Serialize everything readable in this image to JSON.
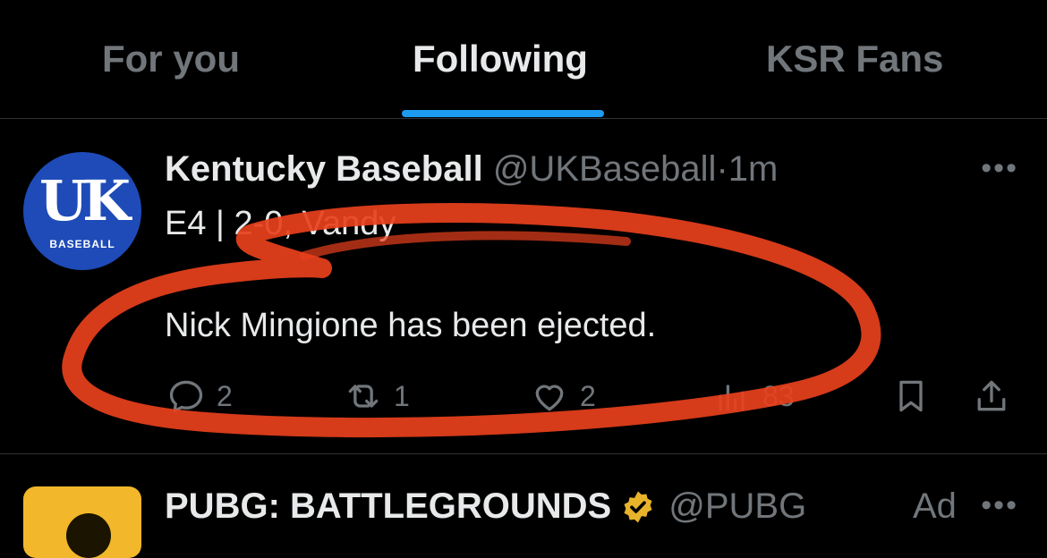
{
  "tabs": [
    "For you",
    "Following",
    "KSR Fans"
  ],
  "post": {
    "author_name": "Kentucky Baseball",
    "author_handle": "@UKBaseball",
    "separator": "·",
    "time": "1m",
    "subline": "E4 | 2-0, Vandy",
    "text": "Nick Mingione has been ejected.",
    "avatar_text": "UK",
    "avatar_subtext": "BASEBALL",
    "replies": "2",
    "reposts": "1",
    "likes": "2",
    "views": "83"
  },
  "post2": {
    "author_name": "PUBG: BATTLEGROUNDS",
    "author_handle": "@PUBG",
    "ad_label": "Ad"
  },
  "colors": {
    "background": "#000000",
    "accent": "#1d9bf0",
    "muted_text": "#71767b",
    "scribble": "#e8401c",
    "verified_badge": "#e8b32a"
  }
}
